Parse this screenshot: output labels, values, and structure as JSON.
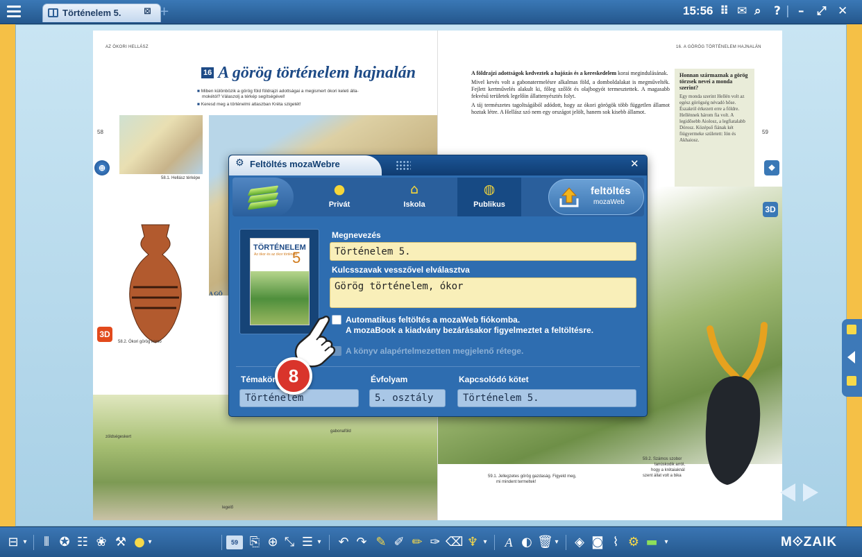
{
  "topbar": {
    "tab_title": "Történelem 5.",
    "clock": "15:56",
    "icons": [
      "menu-icon",
      "book-icon",
      "close-tab-icon",
      "add-tab-icon",
      "grid-icon",
      "mail-icon",
      "search-icon",
      "help-icon",
      "minimize-icon",
      "restore-icon",
      "close-icon"
    ]
  },
  "book": {
    "left_running_head": "AZ ÓKORI HELLÁSZ",
    "right_running_head": "16. A GÖRÖG TÖRTÉNELEM HAJNALÁN",
    "left_page_number": "58",
    "right_page_number": "59",
    "lesson_number": "16",
    "lesson_title": "A görög történelem hajnalán",
    "bullet_1": "Miben különbözik a görög föld földrajzi adottságai a megismert ókori keleti álla-",
    "bullet_1b": "mokétól? Válaszolj a térkép segítségével!",
    "bullet_2": "Keresd meg a történelmi atlaszban Kréta szigetét!",
    "caption_map": "58.1. Hellász térképe",
    "caption_vase": "58.2. Ókori görög korsó",
    "left_heading_fragment": "A GÖ",
    "caption_bottom": "59.1. Jellegzetes görög gazdaság. Figyeld meg,",
    "caption_bottom_2": "mi mindent termeltek!",
    "caption_bull": "59.2. Számos szobor",
    "caption_bull_2": "tanúskodik arról,",
    "caption_bull_3": "hogy a krétaiaknál",
    "caption_bull_4": "szent állat volt a bika",
    "label_gabonafold": "gabonaföld",
    "label_zoldseg": "zöldségeskert",
    "label_legelo": "legelő",
    "badge_3d": "3D",
    "right_para_1_bold": "A földrajzi adottságok kedveztek a hajózás és a kereskedelem",
    "right_para_1": " korai megindulásának.",
    "right_para_2": "Mivel kevés volt a gabonatermelésre alkalmas föld, a domboldalakat is megművelték. Fejlett kertművelés alakult ki, főleg szőlőt és olajbogyót termesztettek. A magasabb fekvésű területek legelőin állattenyésztés folyt.",
    "right_para_3": "A táj természetes tagoltságából adódott, hogy az ókori görögök több független államot hoztak létre. A Hellász szó nem egy országot jelölt, hanem sok kisebb államot.",
    "sidebar_title": "Honnan származnak a görög törzsek nevei a monda szerint?",
    "sidebar_text": "Egy monda szerint Hellén volt az egész görögség névadó hőse. Északról érkezett erre a földre. Hellénnek három fia volt. A legidősebb Aiolosz, a legfiatalabb Dórosz. Középső fiának két fiúgyermeke született: Ión és Akhaiosz."
  },
  "dialog": {
    "title": "Feltöltés mozaWebre",
    "tabs": [
      {
        "label": "Privát",
        "icon": "person-icon"
      },
      {
        "label": "Iskola",
        "icon": "school-icon"
      },
      {
        "label": "Publikus",
        "icon": "globe-icon"
      }
    ],
    "upload_label": "feltöltés",
    "upload_sub": "mozaWeb",
    "cover_title": "TÖRTÉNELEM",
    "cover_sub": "Az ókor és az ókor\ntörténete",
    "cover_num": "5",
    "name_label": "Megnevezés",
    "name_value": "Történelem 5.",
    "keywords_label": "Kulcsszavak vesszővel elválasztva",
    "keywords_value": "Görög történelem, ókor",
    "auto_upload_line1": "Automatikus feltöltés a mozaWeb fiókomba.",
    "auto_upload_line2": "A mozaBook a kiadvány bezárásakor figyelmeztet a feltöltésre.",
    "layers_label": "A könyv alapértelmezetten megjelenő rétege.",
    "topic_label": "Témakör",
    "topic_value": "Történelem",
    "grade_label": "Évfolyam",
    "grade_value": "5. osztály",
    "related_label": "Kapcsolódó kötet",
    "related_value": "Történelem 5."
  },
  "step_badge": "8",
  "bottombar": {
    "page_number": "59",
    "brand": "M⟐ZAIK",
    "icons": [
      "board-icon",
      "columns-icon",
      "lasso-icon",
      "notes-icon",
      "gallery-icon",
      "tools-icon",
      "bulb-icon",
      "page-fit-icon",
      "zoom-icon",
      "path-icon",
      "list-icon",
      "undo-icon",
      "redo-icon",
      "pen-icon",
      "marker-icon",
      "highlighter-icon",
      "shape-pen-icon",
      "eraser-icon",
      "brush-icon",
      "text-icon",
      "spot-icon",
      "trash-icon",
      "compass-icon",
      "camera-icon",
      "clip-icon",
      "settings-icon",
      "battery-icon"
    ]
  },
  "colors": {
    "bar_blue": "#24578c",
    "dialog_blue": "#2e6db0",
    "field_yellow": "#f9efb9",
    "badge_red": "#d9342b",
    "accent_yellow": "#f5c046"
  }
}
